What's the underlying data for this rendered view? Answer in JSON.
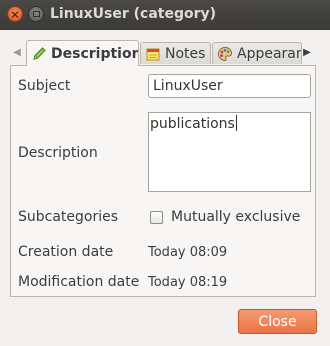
{
  "window": {
    "title": "LinuxUser (category)"
  },
  "tabs": [
    {
      "label": "Description",
      "icon": "pencil-icon",
      "active": true
    },
    {
      "label": "Notes",
      "icon": "note-icon",
      "active": false
    },
    {
      "label": "Appearan",
      "icon": "palette-icon",
      "active": false
    }
  ],
  "form": {
    "subject_label": "Subject",
    "subject_value": "LinuxUser",
    "description_label": "Description",
    "description_value": "publications",
    "subcategories_label": "Subcategories",
    "mutually_exclusive_label": "Mutually exclusive",
    "mutually_exclusive_checked": false,
    "creation_date_label": "Creation date",
    "creation_date_value": "Today 08:09",
    "modification_date_label": "Modification date",
    "modification_date_value": "Today 08:19"
  },
  "buttons": {
    "close_label": "Close"
  },
  "colors": {
    "titlebar": "#3c3b37",
    "accent_button": "#ef8050"
  }
}
